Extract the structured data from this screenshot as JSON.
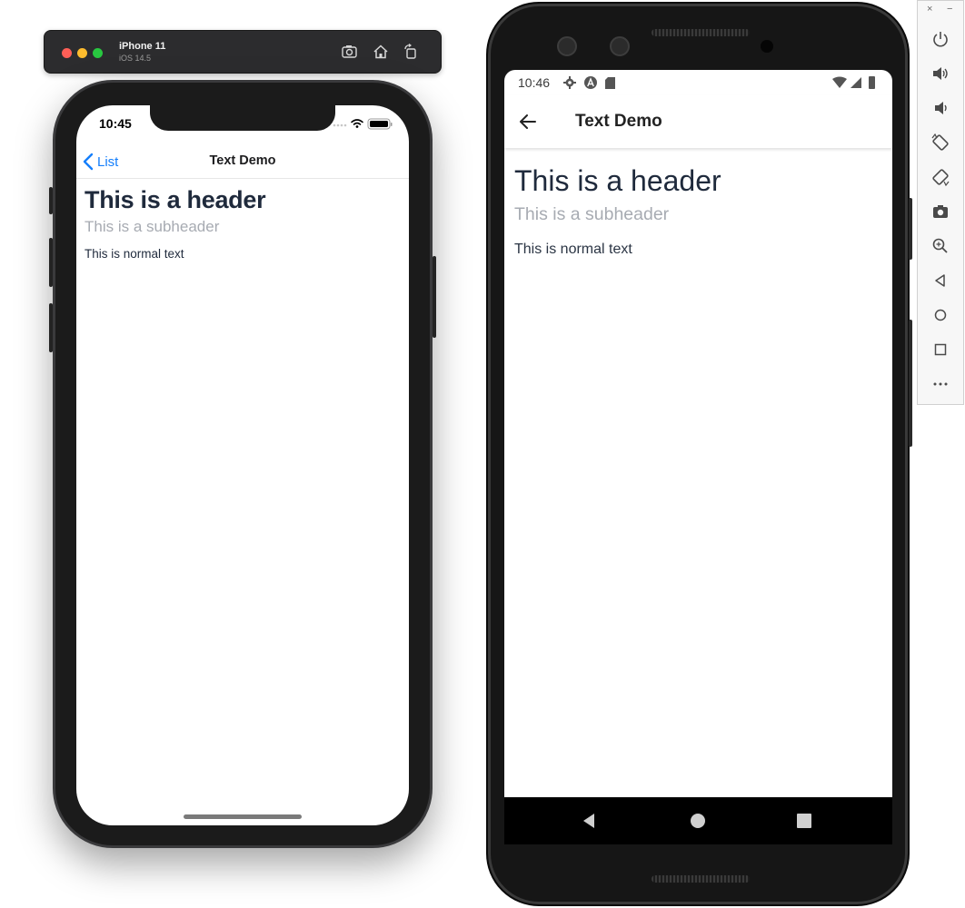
{
  "ios_simulator": {
    "device_name": "iPhone 11",
    "os_version": "iOS 14.5",
    "toolbar_icons": [
      "screenshot-icon",
      "home-icon",
      "rotate-icon"
    ],
    "status_time": "10:45",
    "nav": {
      "back_label": "List",
      "title": "Text Demo"
    },
    "content": {
      "header": "This is a header",
      "subheader": "This is a subheader",
      "normal_text": "This is normal text"
    }
  },
  "android_emulator": {
    "status_time": "10:46",
    "status_icons": [
      "settings-icon",
      "a-badge-icon",
      "sd-card-icon",
      "wifi-icon",
      "signal-icon",
      "battery-icon"
    ],
    "app_bar": {
      "title": "Text Demo"
    },
    "content": {
      "header": "This is a header",
      "subheader": "This is a subheader",
      "normal_text": "This is normal text"
    },
    "nav_buttons": [
      "back-triangle-icon",
      "home-circle-icon",
      "recents-square-icon"
    ]
  },
  "emulator_controls": {
    "window_close": "×",
    "window_minimize": "−",
    "buttons": [
      "power",
      "volume-up",
      "volume-down",
      "rotate-left",
      "rotate-right",
      "screenshot",
      "zoom",
      "back",
      "home",
      "overview",
      "more"
    ]
  },
  "colors": {
    "ios_accent": "#147efb",
    "text_dark": "#1f2a3c",
    "text_muted": "#a7abb2"
  }
}
